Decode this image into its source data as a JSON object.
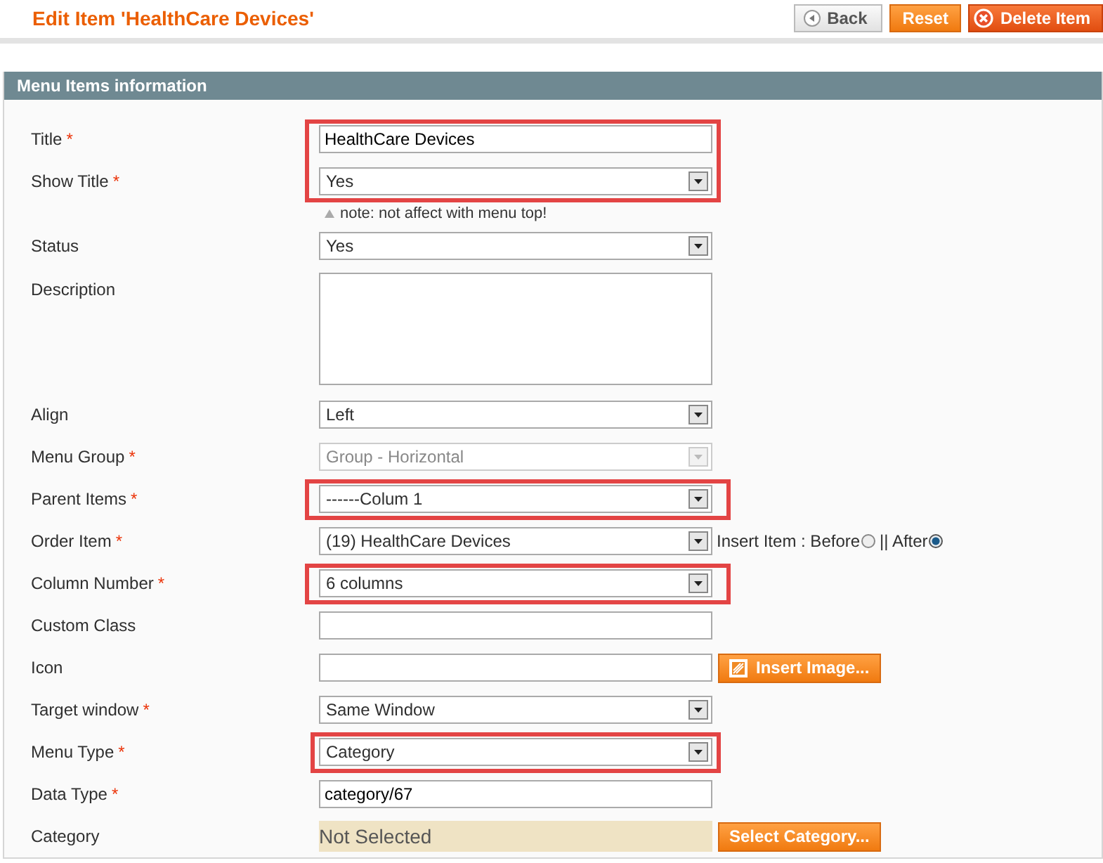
{
  "header": {
    "title": "Edit Item 'HealthCare Devices'",
    "buttons": [
      {
        "label": "Back",
        "kind": "back"
      },
      {
        "label": "Reset",
        "kind": "reset"
      },
      {
        "label": "Delete Item",
        "kind": "delete"
      }
    ]
  },
  "section": {
    "title": "Menu Items information"
  },
  "blocks": [
    {
      "highlighted": true,
      "rows": [
        {
          "kind": "text",
          "label": "Title",
          "mark": "*",
          "value": "HealthCare Devices"
        },
        {
          "kind": "select",
          "label": "Show Title",
          "mark": "*",
          "value": "Yes",
          "disabled": false
        }
      ]
    },
    {
      "highlighted": false,
      "rows": [
        {
          "kind": "note",
          "text": "note: not affect with menu top!"
        },
        {
          "kind": "select",
          "label": "Status",
          "value": "Yes",
          "disabled": false
        },
        {
          "kind": "textarea",
          "label": "Description"
        },
        {
          "kind": "select",
          "label": "Align",
          "value": "Left",
          "disabled": false
        },
        {
          "kind": "select",
          "label": "Menu Group",
          "mark": "*",
          "value": "Group - Horizontal",
          "disabled": true
        }
      ]
    },
    {
      "highlighted": true,
      "rows": [
        {
          "kind": "select",
          "label": "Parent Items",
          "mark": "*",
          "value": "------Colum 1",
          "disabled": false
        }
      ]
    },
    {
      "highlighted": false,
      "rows": [
        {
          "kind": "order",
          "label": "Order Item",
          "mark": "*",
          "value": "(19) HealthCare Devices",
          "disabled": false,
          "insert_label": "Insert Item : Before",
          "before_selected": false,
          "after_label": "|| After",
          "after_selected": true
        }
      ]
    },
    {
      "highlighted": true,
      "rows": [
        {
          "kind": "select",
          "label": "Column Number",
          "mark": "*",
          "value": "6 columns",
          "disabled": false
        }
      ]
    },
    {
      "highlighted": false,
      "rows": [
        {
          "kind": "text",
          "label": "Custom Class"
        },
        {
          "kind": "image",
          "label": "Icon",
          "button": "Insert Image..."
        },
        {
          "kind": "select",
          "label": "Target window",
          "mark": "*",
          "value": "Same Window",
          "disabled": false
        }
      ]
    },
    {
      "highlighted": true,
      "rows": [
        {
          "kind": "select",
          "label": "Menu Type",
          "mark": "*",
          "value": "Category",
          "disabled": false
        }
      ]
    },
    {
      "highlighted": false,
      "rows": [
        {
          "kind": "text",
          "label": "Data Type",
          "mark": "*",
          "value": "category/67"
        },
        {
          "kind": "chooser",
          "label": "Category",
          "value": "Not Selected",
          "button": "Select Category..."
        }
      ]
    }
  ]
}
